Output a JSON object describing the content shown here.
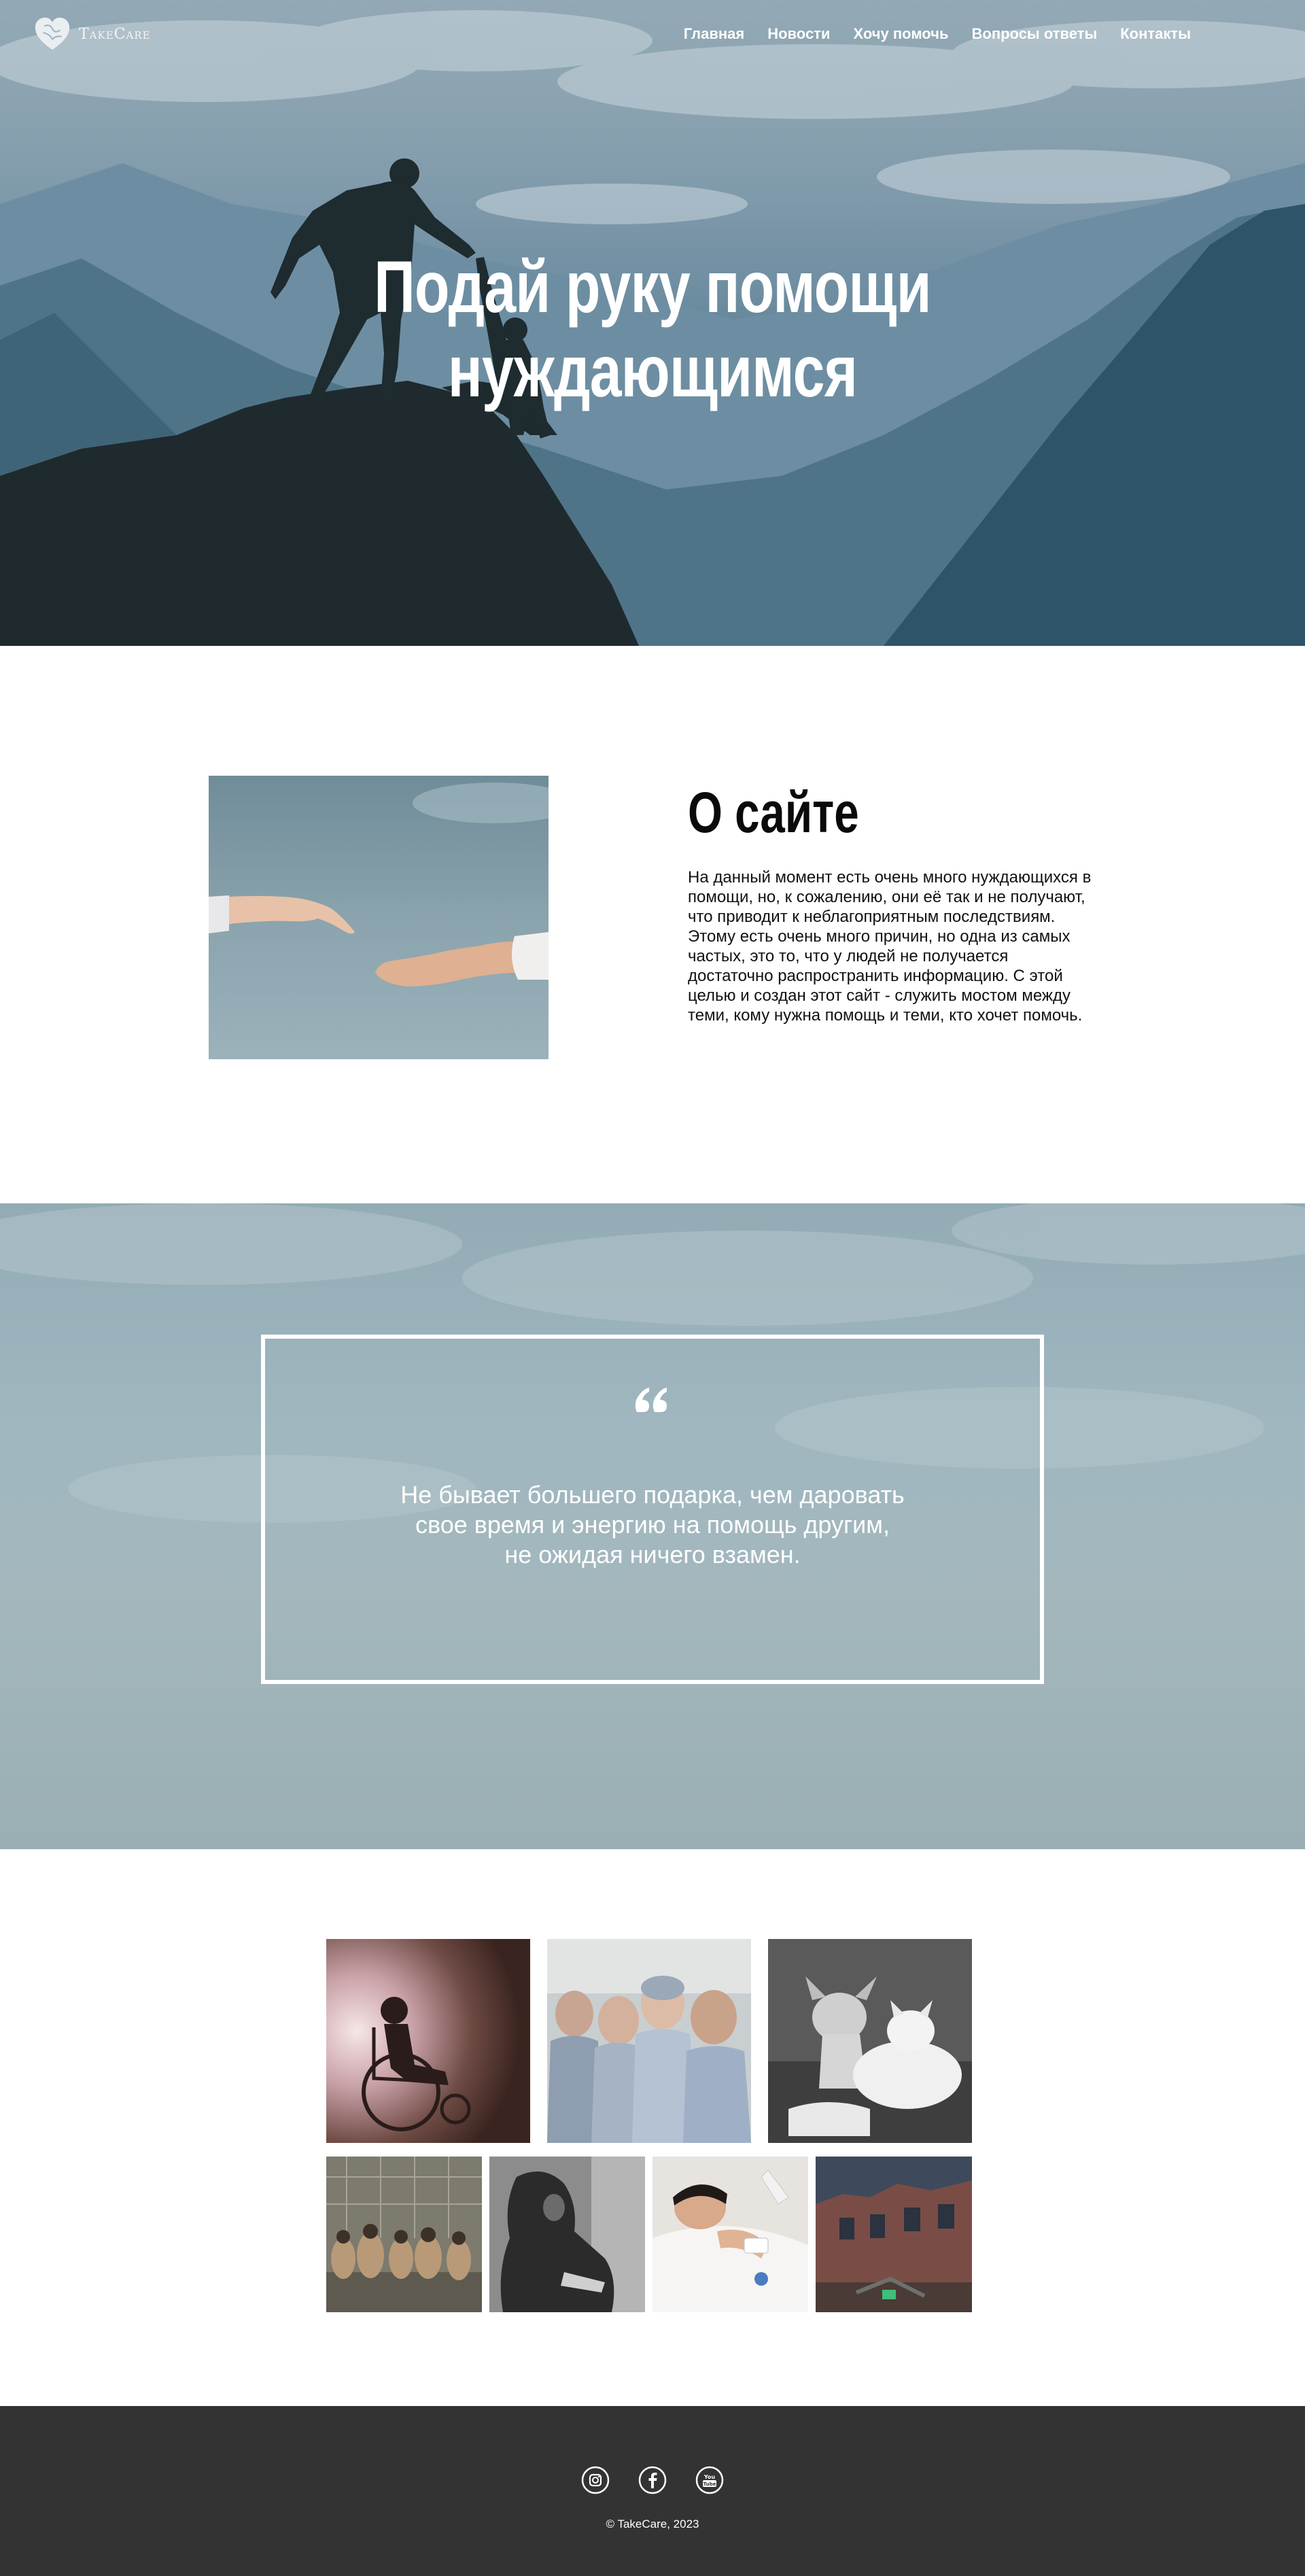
{
  "header": {
    "logo_text": "TakeCare",
    "logo_icon": "heart-icon",
    "nav": [
      {
        "label": "Главная"
      },
      {
        "label": "Новости"
      },
      {
        "label": "Хочу помочь"
      },
      {
        "label": "Вопросы ответы"
      },
      {
        "label": "Контакты"
      }
    ]
  },
  "hero": {
    "title_line1": "Подай руку помощи",
    "title_line2": "нуждающимся"
  },
  "about": {
    "title": "О сайте",
    "text": "На данный момент есть очень много нуждающихся в помощи, но, к сожалению, они её так и не получают, что приводит к неблагоприятным последствиям. Этому есть очень много причин, но одна из самых частых, это то, что у людей не получается достаточно распространить информацию. С этой целью и создан этот сайт - служить мостом между теми, кому нужна помощь и теми, кто хочет помочь."
  },
  "quote": {
    "icon": "quote-icon",
    "line1": "Не бывает большего подарка, чем даровать",
    "line2": "свое время и энергию на помощь другим,",
    "line3": "не ожидая ничего взамен."
  },
  "footer": {
    "socials": [
      {
        "icon": "instagram-icon"
      },
      {
        "icon": "facebook-icon"
      },
      {
        "icon": "youtube-icon"
      }
    ],
    "copyright": "© TakeCare, 2023"
  },
  "colors": {
    "footer_bg": "#333333",
    "text_white": "#ffffff",
    "hero_sky": "#8aa2b0",
    "hero_deep": "#234a5e"
  }
}
